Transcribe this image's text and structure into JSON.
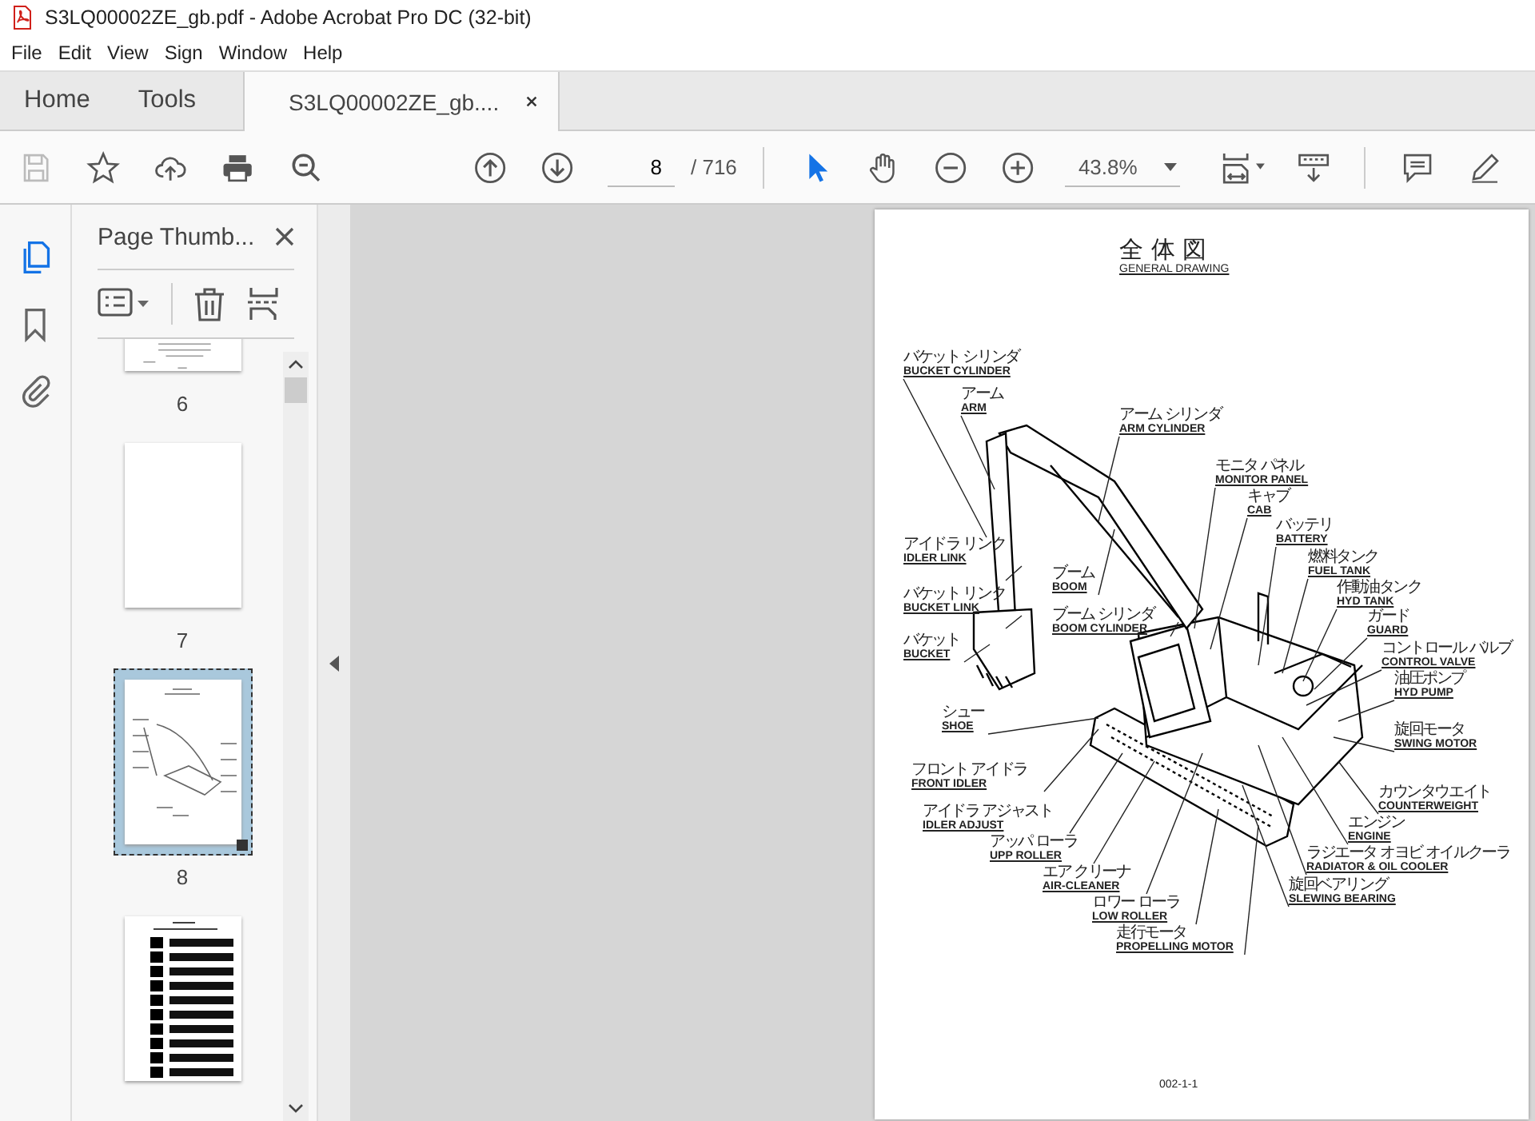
{
  "window": {
    "title": "S3LQ00002ZE_gb.pdf - Adobe Acrobat Pro DC (32-bit)"
  },
  "menu": [
    "File",
    "Edit",
    "View",
    "Sign",
    "Window",
    "Help"
  ],
  "tabs": [
    {
      "label": "Home",
      "selected": false
    },
    {
      "label": "Tools",
      "selected": false
    },
    {
      "label": "S3LQ00002ZE_gb....",
      "selected": true
    }
  ],
  "toolbar": {
    "save_disabled": true,
    "page": "8",
    "page_total": "/ 716",
    "zoom": "43.8%",
    "cursor_tools": [
      {
        "selected": true
      },
      {
        "selected": false
      }
    ]
  },
  "left_rail": [
    {
      "selected": true
    },
    {
      "selected": false
    },
    {
      "selected": false
    }
  ],
  "thumbnails_panel": {
    "title": "Page Thumb...",
    "pages": [
      {
        "label": "6",
        "selected": false
      },
      {
        "label": "7",
        "selected": false
      },
      {
        "label": "8",
        "selected": true
      }
    ]
  },
  "document_page": {
    "title": "全 体 図",
    "subtitle": "GENERAL DRAWING",
    "footer": "002-1-1",
    "labels": [
      {
        "jp": "バケット シリンダ",
        "en": "BUCKET CYLINDER"
      },
      {
        "jp": "アーム",
        "en": "ARM"
      },
      {
        "jp": "アーム シリンダ",
        "en": "ARM CYLINDER"
      },
      {
        "jp": "モニタ パネル",
        "en": "MONITOR PANEL"
      },
      {
        "jp": "キャブ",
        "en": "CAB"
      },
      {
        "jp": "バッテリ",
        "en": "BATTERY"
      },
      {
        "jp": "アイドラ リンク",
        "en": "IDLER LINK"
      },
      {
        "jp": "燃料タンク",
        "en": "FUEL TANK"
      },
      {
        "jp": "ブーム",
        "en": "BOOM"
      },
      {
        "jp": "作動油タンク",
        "en": "HYD TANK"
      },
      {
        "jp": "バケット リンク",
        "en": "BUCKET LINK"
      },
      {
        "jp": "ブーム シリンダ",
        "en": "BOOM CYLINDER"
      },
      {
        "jp": "ガード",
        "en": "GUARD"
      },
      {
        "jp": "バケット",
        "en": "BUCKET"
      },
      {
        "jp": "コントロール バルブ",
        "en": "CONTROL VALVE"
      },
      {
        "jp": "油圧ポンプ",
        "en": "HYD PUMP"
      },
      {
        "jp": "シュー",
        "en": "SHOE"
      },
      {
        "jp": "旋回モータ",
        "en": "SWING MOTOR"
      },
      {
        "jp": "フロント アイドラ",
        "en": "FRONT IDLER"
      },
      {
        "jp": "カウンタウエイト",
        "en": "COUNTERWEIGHT"
      },
      {
        "jp": "アイドラ アジャスト",
        "en": "IDLER ADJUST"
      },
      {
        "jp": "エンジン",
        "en": "ENGINE"
      },
      {
        "jp": "アッパ ローラ",
        "en": "UPP ROLLER"
      },
      {
        "jp": "ラジエータ オヨビ オイルクーラ",
        "en": "RADIATOR & OIL COOLER"
      },
      {
        "jp": "エア クリーナ",
        "en": "AIR-CLEANER"
      },
      {
        "jp": "旋回ベアリング",
        "en": "SLEWING BEARING"
      },
      {
        "jp": "ロワー ローラ",
        "en": "LOW ROLLER"
      },
      {
        "jp": "走行モータ",
        "en": "PROPELLING MOTOR"
      }
    ]
  }
}
